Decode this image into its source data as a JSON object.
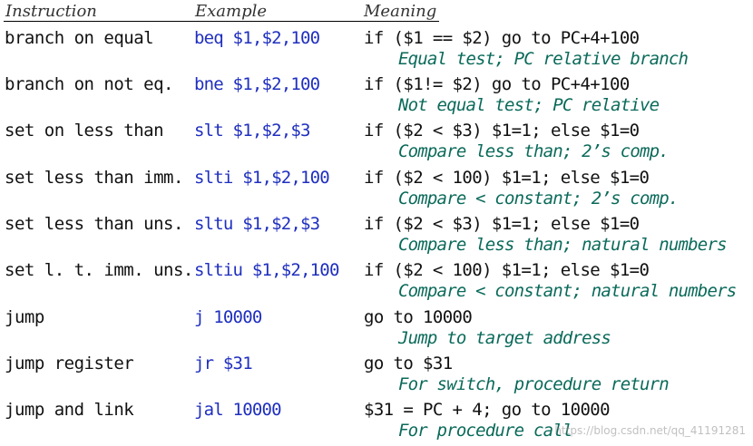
{
  "header": {
    "instruction": "Instruction",
    "example": "Example",
    "meaning": "Meaning"
  },
  "rows": [
    {
      "instruction": "branch on equal",
      "example": "beq $1,$2,100",
      "meaning": "if ($1 == $2) go to PC+4+100",
      "comment": "Equal test; PC relative branch"
    },
    {
      "instruction": "branch on not eq.",
      "example": "bne $1,$2,100",
      "meaning": "if ($1!= $2) go to PC+4+100",
      "comment": "Not equal test; PC relative"
    },
    {
      "instruction": "set on less than",
      "example": "slt $1,$2,$3",
      "meaning": "if ($2 < $3) $1=1; else $1=0",
      "comment": "Compare less than; 2’s comp."
    },
    {
      "instruction": "set less than imm.",
      "example": "slti $1,$2,100",
      "meaning": "if ($2 < 100) $1=1; else $1=0",
      "comment": "Compare < constant; 2’s comp."
    },
    {
      "instruction": "set less than uns.",
      "example": "sltu $1,$2,$3",
      "meaning": "if ($2 < $3) $1=1; else $1=0",
      "comment": "Compare less than; natural numbers"
    },
    {
      "instruction": "set l. t. imm. uns.",
      "example": "sltiu $1,$2,100",
      "meaning": "if ($2 < 100) $1=1; else $1=0",
      "comment": "Compare < constant; natural numbers"
    },
    {
      "instruction": "jump",
      "example": "j 10000",
      "meaning": "go to 10000",
      "comment": "Jump to target address"
    },
    {
      "instruction": "jump register",
      "example": "jr $31",
      "meaning": "go to $31",
      "comment": "For switch, procedure return"
    },
    {
      "instruction": "jump and link",
      "example": "jal 10000",
      "meaning": "$31 = PC + 4; go to 10000",
      "comment": "For procedure call"
    }
  ],
  "watermark": "https://blog.csdn.net/qq_41191281"
}
